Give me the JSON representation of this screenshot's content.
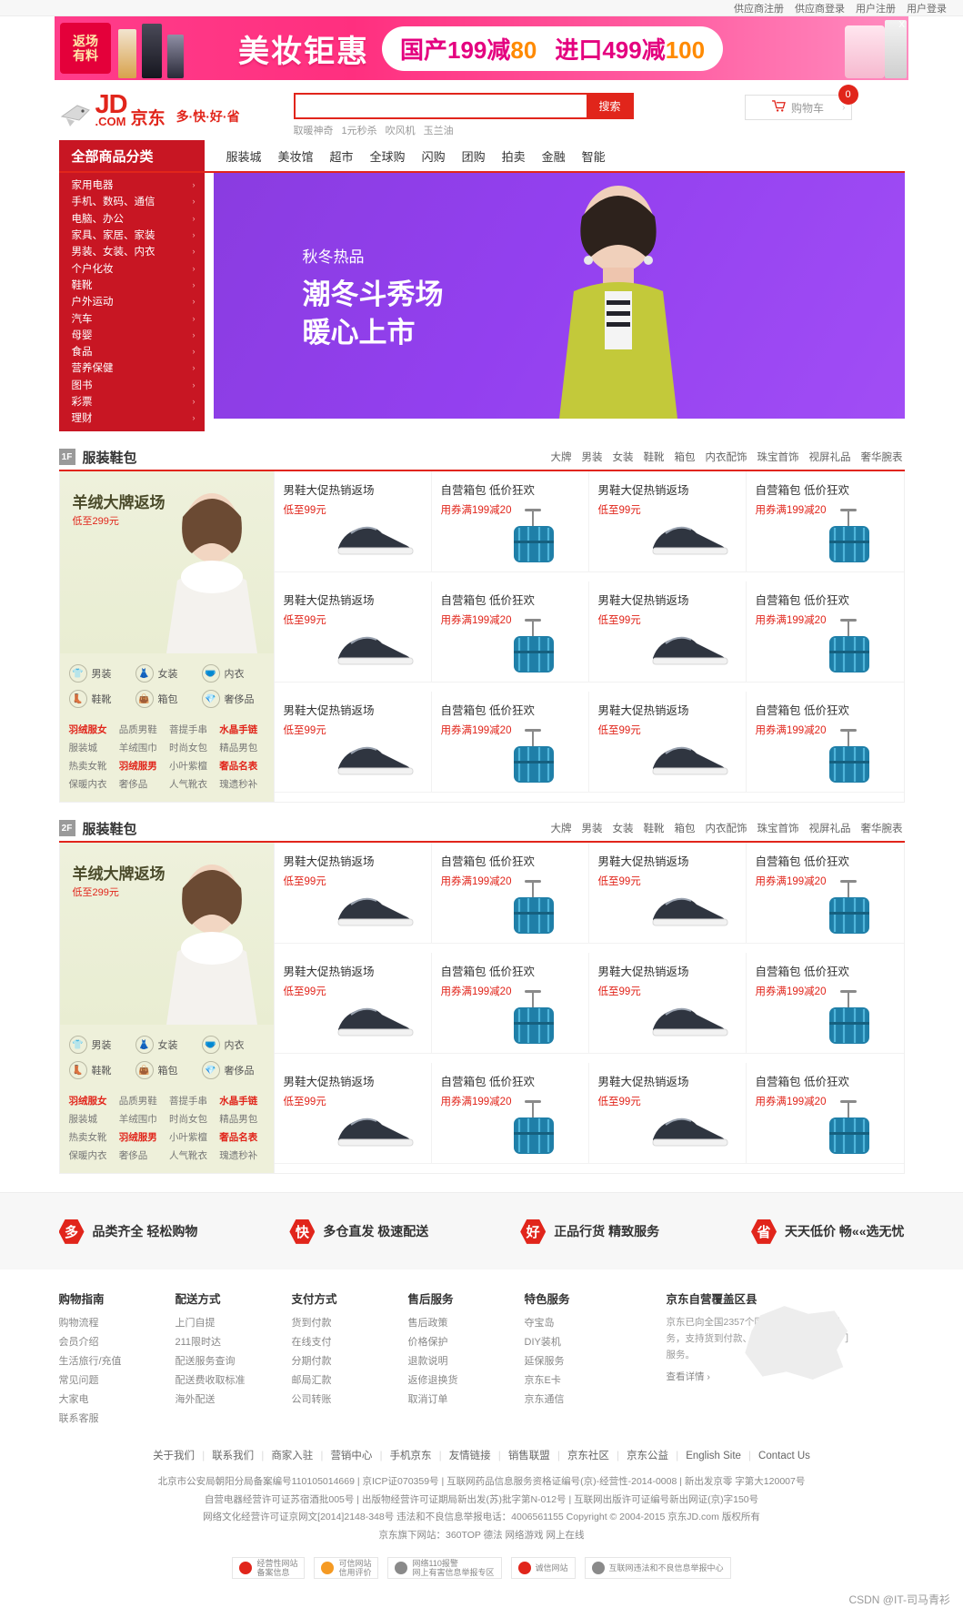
{
  "topbar": {
    "links": [
      "供应商注册",
      "供应商登录",
      "用户注册",
      "用户登录"
    ]
  },
  "promo": {
    "badge_line1": "返场",
    "badge_line2": "有料",
    "title": "美妆钜惠",
    "offer1_prefix": "国产199减",
    "offer1_num": "80",
    "offer2_prefix": "进口499减",
    "offer2_num": "100",
    "close": "X"
  },
  "header": {
    "logo_main": "JD",
    "logo_dom": ".COM",
    "logo_cn": "京东",
    "slogan": "多·快·好·省",
    "search_value": "",
    "search_placeholder": "",
    "search_button": "搜索",
    "hotwords": [
      "取暖神奇",
      "1元秒杀",
      "吹风机",
      "玉兰油"
    ],
    "cart_label": "购物车",
    "cart_count": "0",
    "cart_arrow": "›"
  },
  "nav": {
    "all_categories": "全部商品分类",
    "links": [
      "服装城",
      "美妆馆",
      "超市",
      "全球购",
      "闪购",
      "团购",
      "拍卖",
      "金融",
      "智能"
    ]
  },
  "categories": [
    "家用电器",
    "手机、数码、通信",
    "电脑、办公",
    "家具、家居、家装",
    "男装、女装、内衣",
    "个户化妆",
    "鞋靴",
    "户外运动",
    "汽车",
    "母婴",
    "食品",
    "营养保健",
    "图书",
    "彩票",
    "理财"
  ],
  "hero": {
    "sub": "秋冬热品",
    "line1": "潮冬斗秀场",
    "line2": "暖心上市"
  },
  "floors": [
    {
      "badge": "1F",
      "title": "服装鞋包",
      "tabs": [
        "大牌",
        "男装",
        "女装",
        "鞋靴",
        "箱包",
        "内衣配饰",
        "珠宝首饰",
        "视屏礼品",
        "奢华腕表"
      ],
      "promo": {
        "title": "羊绒大牌返场",
        "sub": "低至299元",
        "icons": [
          {
            "glyph": "👕",
            "label": "男装"
          },
          {
            "glyph": "👗",
            "label": "女装"
          },
          {
            "glyph": "🩲",
            "label": "内衣"
          },
          {
            "glyph": "👢",
            "label": "鞋靴"
          },
          {
            "glyph": "👜",
            "label": "箱包"
          },
          {
            "glyph": "💎",
            "label": "奢侈品"
          }
        ],
        "links": [
          {
            "t": "羽绒服女",
            "hot": true
          },
          {
            "t": "品质男鞋",
            "hot": false
          },
          {
            "t": "菩提手串",
            "hot": false
          },
          {
            "t": "水晶手链",
            "hot": true
          },
          {
            "t": "服装城",
            "hot": false
          },
          {
            "t": "羊绒围巾",
            "hot": false
          },
          {
            "t": "时尚女包",
            "hot": false
          },
          {
            "t": "精品男包",
            "hot": false
          },
          {
            "t": "热卖女靴",
            "hot": false
          },
          {
            "t": "羽绒服男",
            "hot": true
          },
          {
            "t": "小叶紫檀",
            "hot": false
          },
          {
            "t": "奢品名表",
            "hot": true
          },
          {
            "t": "保暖内衣",
            "hot": false
          },
          {
            "t": "奢侈品",
            "hot": false
          },
          {
            "t": "人气靴衣",
            "hot": false
          },
          {
            "t": "瑰遗秒补",
            "hot": false
          }
        ]
      },
      "cells": [
        {
          "t1": "男鞋大促热销返场",
          "t2": "低至99元",
          "kind": "shoe"
        },
        {
          "t1": "自营箱包 低价狂欢",
          "t2": "用券满199减20",
          "kind": "bag"
        },
        {
          "t1": "男鞋大促热销返场",
          "t2": "低至99元",
          "kind": "shoe"
        },
        {
          "t1": "自营箱包 低价狂欢",
          "t2": "用券满199减20",
          "kind": "bag"
        },
        {
          "t1": "男鞋大促热销返场",
          "t2": "低至99元",
          "kind": "shoe"
        },
        {
          "t1": "自营箱包 低价狂欢",
          "t2": "用券满199减20",
          "kind": "bag"
        },
        {
          "t1": "男鞋大促热销返场",
          "t2": "低至99元",
          "kind": "shoe"
        },
        {
          "t1": "自营箱包 低价狂欢",
          "t2": "用券满199减20",
          "kind": "bag"
        },
        {
          "t1": "男鞋大促热销返场",
          "t2": "低至99元",
          "kind": "shoe"
        },
        {
          "t1": "自营箱包 低价狂欢",
          "t2": "用券满199减20",
          "kind": "bag"
        },
        {
          "t1": "男鞋大促热销返场",
          "t2": "低至99元",
          "kind": "shoe"
        },
        {
          "t1": "自营箱包 低价狂欢",
          "t2": "用券满199减20",
          "kind": "bag"
        }
      ]
    },
    {
      "badge": "2F",
      "title": "服装鞋包",
      "tabs": [
        "大牌",
        "男装",
        "女装",
        "鞋靴",
        "箱包",
        "内衣配饰",
        "珠宝首饰",
        "视屏礼品",
        "奢华腕表"
      ],
      "promo": {
        "title": "羊绒大牌返场",
        "sub": "低至299元",
        "icons": [
          {
            "glyph": "👕",
            "label": "男装"
          },
          {
            "glyph": "👗",
            "label": "女装"
          },
          {
            "glyph": "🩲",
            "label": "内衣"
          },
          {
            "glyph": "👢",
            "label": "鞋靴"
          },
          {
            "glyph": "👜",
            "label": "箱包"
          },
          {
            "glyph": "💎",
            "label": "奢侈品"
          }
        ],
        "links": [
          {
            "t": "羽绒服女",
            "hot": true
          },
          {
            "t": "品质男鞋",
            "hot": false
          },
          {
            "t": "菩提手串",
            "hot": false
          },
          {
            "t": "水晶手链",
            "hot": true
          },
          {
            "t": "服装城",
            "hot": false
          },
          {
            "t": "羊绒围巾",
            "hot": false
          },
          {
            "t": "时尚女包",
            "hot": false
          },
          {
            "t": "精品男包",
            "hot": false
          },
          {
            "t": "热卖女靴",
            "hot": false
          },
          {
            "t": "羽绒服男",
            "hot": true
          },
          {
            "t": "小叶紫檀",
            "hot": false
          },
          {
            "t": "奢品名表",
            "hot": true
          },
          {
            "t": "保暖内衣",
            "hot": false
          },
          {
            "t": "奢侈品",
            "hot": false
          },
          {
            "t": "人气靴衣",
            "hot": false
          },
          {
            "t": "瑰遗秒补",
            "hot": false
          }
        ]
      },
      "cells": [
        {
          "t1": "男鞋大促热销返场",
          "t2": "低至99元",
          "kind": "shoe"
        },
        {
          "t1": "自营箱包 低价狂欢",
          "t2": "用券满199减20",
          "kind": "bag"
        },
        {
          "t1": "男鞋大促热销返场",
          "t2": "低至99元",
          "kind": "shoe"
        },
        {
          "t1": "自营箱包 低价狂欢",
          "t2": "用券满199减20",
          "kind": "bag"
        },
        {
          "t1": "男鞋大促热销返场",
          "t2": "低至99元",
          "kind": "shoe"
        },
        {
          "t1": "自营箱包 低价狂欢",
          "t2": "用券满199减20",
          "kind": "bag"
        },
        {
          "t1": "男鞋大促热销返场",
          "t2": "低至99元",
          "kind": "shoe"
        },
        {
          "t1": "自营箱包 低价狂欢",
          "t2": "用券满199减20",
          "kind": "bag"
        },
        {
          "t1": "男鞋大促热销返场",
          "t2": "低至99元",
          "kind": "shoe"
        },
        {
          "t1": "自营箱包 低价狂欢",
          "t2": "用券满199减20",
          "kind": "bag"
        },
        {
          "t1": "男鞋大促热销返场",
          "t2": "低至99元",
          "kind": "shoe"
        },
        {
          "t1": "自营箱包 低价狂欢",
          "t2": "用券满199减20",
          "kind": "bag"
        }
      ]
    }
  ],
  "services": [
    {
      "glyph": "多",
      "text": "品类齐全  轻松购物"
    },
    {
      "glyph": "快",
      "text": "多仓直发  极速配送"
    },
    {
      "glyph": "好",
      "text": "正品行货  精致服务"
    },
    {
      "glyph": "省",
      "text": "天天低价  畅««选无忧"
    }
  ],
  "footer": {
    "columns": [
      {
        "title": "购物指南",
        "items": [
          "购物流程",
          "会员介绍",
          "生活旅行/充值",
          "常见问题",
          "大家电",
          "联系客服"
        ]
      },
      {
        "title": "配送方式",
        "items": [
          "上门自提",
          "211限时达",
          "配送服务查询",
          "配送费收取标准",
          "海外配送"
        ]
      },
      {
        "title": "支付方式",
        "items": [
          "货到付款",
          "在线支付",
          "分期付款",
          "邮局汇款",
          "公司转账"
        ]
      },
      {
        "title": "售后服务",
        "items": [
          "售后政策",
          "价格保护",
          "退款说明",
          "返修退换货",
          "取消订单"
        ]
      },
      {
        "title": "特色服务",
        "items": [
          "夺宝岛",
          "DIY装机",
          "延保服务",
          "京东E卡",
          "京东通信"
        ]
      }
    ],
    "map": {
      "title": "京东自营覆盖区县",
      "text": "京东已向全国2357个区县提供自营配送服务，支持货到付款、POS机刷卡和配葛上门服务。",
      "more": "查看详情 ›"
    },
    "links": [
      "关于我们",
      "联系我们",
      "商家入驻",
      "营销中心",
      "手机京东",
      "友情链接",
      "销售联盟",
      "京东社区",
      "京东公益",
      "English Site",
      "Contact Us"
    ],
    "legal": [
      "北京市公安局朝阳分局备案编号110105014669 | 京ICP证070359号 | 互联网药品信息服务资格证编号(京)-经营性-2014-0008 | 新出发京零 字第大120007号",
      "自营电器经营许可证苏宿酒批005号 | 出版物经营许可证期局新出发(苏)批字第N-012号 | 互联网出版许可证编号新出网证(京)字150号",
      "网络文化经营许可证京网文[2014]2148-348号 违法和不良信息举报电话：4006561155  Copyright © 2004-2015  京东JD.com 版权所有",
      "京东旗下网站：360TOP  德法 网络游戏  网上在线"
    ],
    "badges": [
      {
        "tone": "r",
        "l1": "经营性网站",
        "l2": "备案信息"
      },
      {
        "tone": "o",
        "l1": "可信网站",
        "l2": "信用评价"
      },
      {
        "tone": "g",
        "l1": "网络110报警",
        "l2": "网上有害信息举报专区"
      },
      {
        "tone": "r",
        "l1": "诚信网站",
        "l2": ""
      },
      {
        "tone": "g",
        "l1": "互联网违法和不良信息举报中心",
        "l2": ""
      }
    ],
    "watermark": "CSDN @IT-司马青衫"
  }
}
